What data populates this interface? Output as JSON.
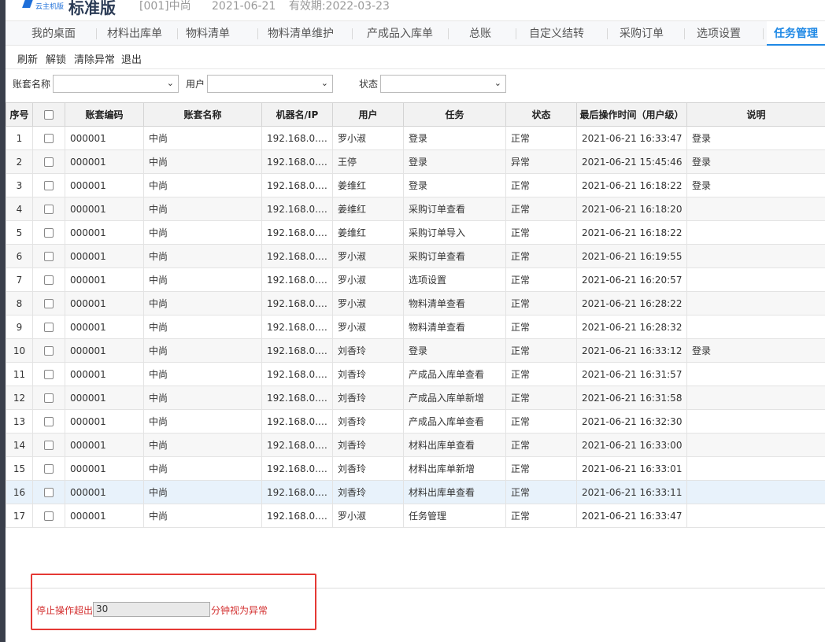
{
  "header": {
    "logo_sub": "云主机版",
    "app_title": "标准版",
    "company": "[001]中尚",
    "login_date": "2021-06-21",
    "valid_until": "有效期:2022-03-23"
  },
  "tabs": [
    {
      "label": "我的桌面"
    },
    {
      "label": "材料出库单"
    },
    {
      "label": "物料清单"
    },
    {
      "label": "物料清单维护"
    },
    {
      "label": "产成品入库单"
    },
    {
      "label": "总账"
    },
    {
      "label": "自定义结转"
    },
    {
      "label": "采购订单"
    },
    {
      "label": "选项设置"
    },
    {
      "label": "任务管理"
    }
  ],
  "toolbar": {
    "refresh": "刷新",
    "unlock": "解锁",
    "clear_exception": "清除异常",
    "exit": "退出"
  },
  "filters": {
    "account_name_label": "账套名称",
    "account_name_value": "",
    "user_label": "用户",
    "user_value": "",
    "status_label": "状态",
    "status_value": ""
  },
  "table": {
    "columns": [
      "序号",
      "",
      "账套编码",
      "账套名称",
      "机器名/IP",
      "用户",
      "任务",
      "状态",
      "最后操作时间（用户级）",
      "说明"
    ],
    "rows": [
      {
        "idx": "1",
        "code": "000001",
        "name": "中尚",
        "ip": "192.168.0.…",
        "user": "罗小淑",
        "task": "登录",
        "status": "正常",
        "time": "2021-06-21 16:33:47",
        "note": "登录"
      },
      {
        "idx": "2",
        "code": "000001",
        "name": "中尚",
        "ip": "192.168.0.…",
        "user": "王停",
        "task": "登录",
        "status": "异常",
        "time": "2021-06-21 15:45:46",
        "note": "登录"
      },
      {
        "idx": "3",
        "code": "000001",
        "name": "中尚",
        "ip": "192.168.0.…",
        "user": "姜维红",
        "task": "登录",
        "status": "正常",
        "time": "2021-06-21 16:18:22",
        "note": "登录"
      },
      {
        "idx": "4",
        "code": "000001",
        "name": "中尚",
        "ip": "192.168.0.…",
        "user": "姜维红",
        "task": "采购订单查看",
        "status": "正常",
        "time": "2021-06-21 16:18:20",
        "note": ""
      },
      {
        "idx": "5",
        "code": "000001",
        "name": "中尚",
        "ip": "192.168.0.…",
        "user": "姜维红",
        "task": "采购订单导入",
        "status": "正常",
        "time": "2021-06-21 16:18:22",
        "note": ""
      },
      {
        "idx": "6",
        "code": "000001",
        "name": "中尚",
        "ip": "192.168.0.…",
        "user": "罗小淑",
        "task": "采购订单查看",
        "status": "正常",
        "time": "2021-06-21 16:19:55",
        "note": ""
      },
      {
        "idx": "7",
        "code": "000001",
        "name": "中尚",
        "ip": "192.168.0.…",
        "user": "罗小淑",
        "task": "选项设置",
        "status": "正常",
        "time": "2021-06-21 16:20:57",
        "note": ""
      },
      {
        "idx": "8",
        "code": "000001",
        "name": "中尚",
        "ip": "192.168.0.…",
        "user": "罗小淑",
        "task": "物料清单查看",
        "status": "正常",
        "time": "2021-06-21 16:28:22",
        "note": ""
      },
      {
        "idx": "9",
        "code": "000001",
        "name": "中尚",
        "ip": "192.168.0.…",
        "user": "罗小淑",
        "task": "物料清单查看",
        "status": "正常",
        "time": "2021-06-21 16:28:32",
        "note": ""
      },
      {
        "idx": "10",
        "code": "000001",
        "name": "中尚",
        "ip": "192.168.0.…",
        "user": "刘香玲",
        "task": "登录",
        "status": "正常",
        "time": "2021-06-21 16:33:12",
        "note": "登录"
      },
      {
        "idx": "11",
        "code": "000001",
        "name": "中尚",
        "ip": "192.168.0.…",
        "user": "刘香玲",
        "task": "产成品入库单查看",
        "status": "正常",
        "time": "2021-06-21 16:31:57",
        "note": ""
      },
      {
        "idx": "12",
        "code": "000001",
        "name": "中尚",
        "ip": "192.168.0.…",
        "user": "刘香玲",
        "task": "产成品入库单新增",
        "status": "正常",
        "time": "2021-06-21 16:31:58",
        "note": ""
      },
      {
        "idx": "13",
        "code": "000001",
        "name": "中尚",
        "ip": "192.168.0.…",
        "user": "刘香玲",
        "task": "产成品入库单查看",
        "status": "正常",
        "time": "2021-06-21 16:32:30",
        "note": ""
      },
      {
        "idx": "14",
        "code": "000001",
        "name": "中尚",
        "ip": "192.168.0.…",
        "user": "刘香玲",
        "task": "材料出库单查看",
        "status": "正常",
        "time": "2021-06-21 16:33:00",
        "note": ""
      },
      {
        "idx": "15",
        "code": "000001",
        "name": "中尚",
        "ip": "192.168.0.…",
        "user": "刘香玲",
        "task": "材料出库单新增",
        "status": "正常",
        "time": "2021-06-21 16:33:01",
        "note": ""
      },
      {
        "idx": "16",
        "code": "000001",
        "name": "中尚",
        "ip": "192.168.0.…",
        "user": "刘香玲",
        "task": "材料出库单查看",
        "status": "正常",
        "time": "2021-06-21 16:33:11",
        "note": ""
      },
      {
        "idx": "17",
        "code": "000001",
        "name": "中尚",
        "ip": "192.168.0.…",
        "user": "罗小淑",
        "task": "任务管理",
        "status": "正常",
        "time": "2021-06-21 16:33:47",
        "note": ""
      }
    ],
    "selected_row": "16"
  },
  "timeout": {
    "prefix": "停止操作超出",
    "minutes": "30",
    "suffix": "分钟视为异常"
  },
  "colors": {
    "accent": "#1e88e5",
    "warning": "#d32f2f"
  }
}
